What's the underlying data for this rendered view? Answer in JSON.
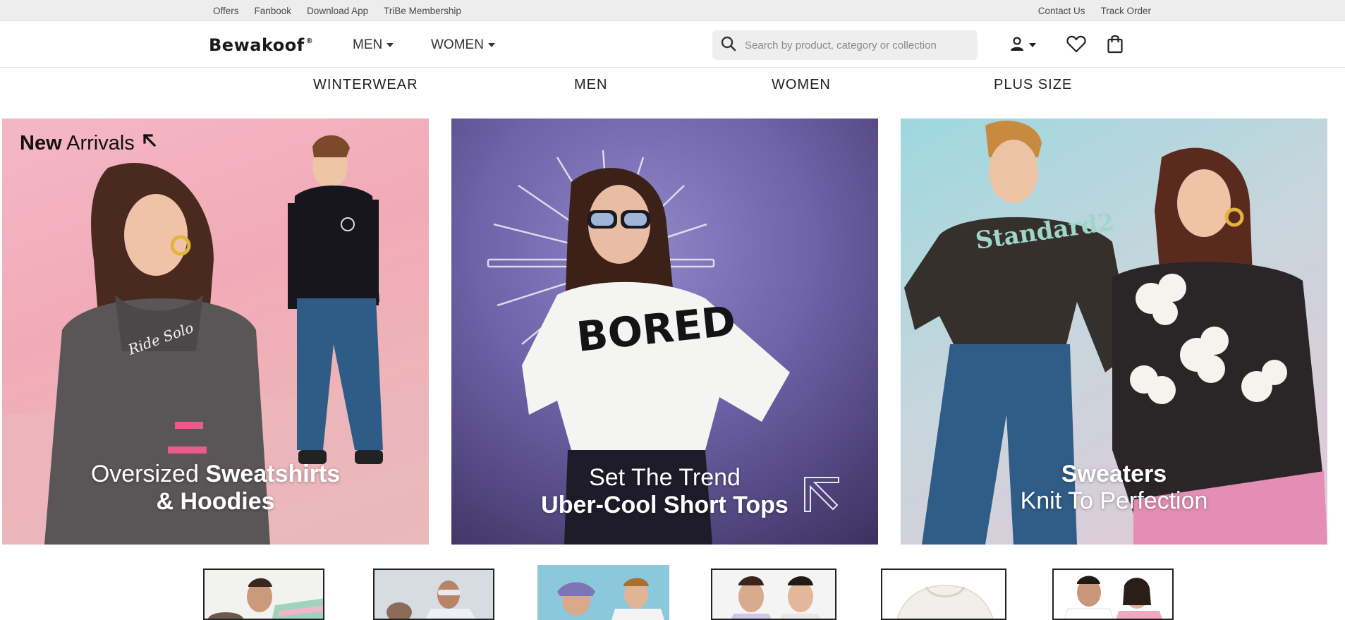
{
  "topbar": {
    "left_links": [
      "Offers",
      "Fanbook",
      "Download App",
      "TriBe Membership"
    ],
    "right_links": [
      "Contact Us",
      "Track Order"
    ]
  },
  "header": {
    "logo_text": "Bewakoof",
    "logo_mark": "®",
    "nav": [
      "MEN",
      "WOMEN"
    ],
    "search_placeholder": "Search by product, category or collection"
  },
  "categories": [
    "WINTERWEAR",
    "MEN",
    "WOMEN",
    "PLUS SIZE"
  ],
  "banners": [
    {
      "badge_bold": "New",
      "badge_rest": "Arrivals",
      "line1_light": "Oversized ",
      "line1_bold": "Sweatshirts",
      "line2": "& Hoodies"
    },
    {
      "line1": "Set The Trend",
      "line2": "Uber-Cool Short Tops"
    },
    {
      "line1": "Sweaters",
      "line2": "Knit To Perfection"
    }
  ],
  "graphic_text": {
    "hoodie": "Ride Solo",
    "tshirt": "BORED",
    "sweatshirt": "Standard2"
  },
  "colors": {
    "topbar_bg": "#ededed",
    "search_bg": "#eeeeee",
    "banner1_bg": "#f2a6b4",
    "banner2_bg": "#6e62a8",
    "banner3_bg": "#9ed7df"
  },
  "icons": [
    "search-icon",
    "user-icon",
    "wishlist-heart-icon",
    "cart-bag-icon",
    "arrow-up-left-icon"
  ]
}
